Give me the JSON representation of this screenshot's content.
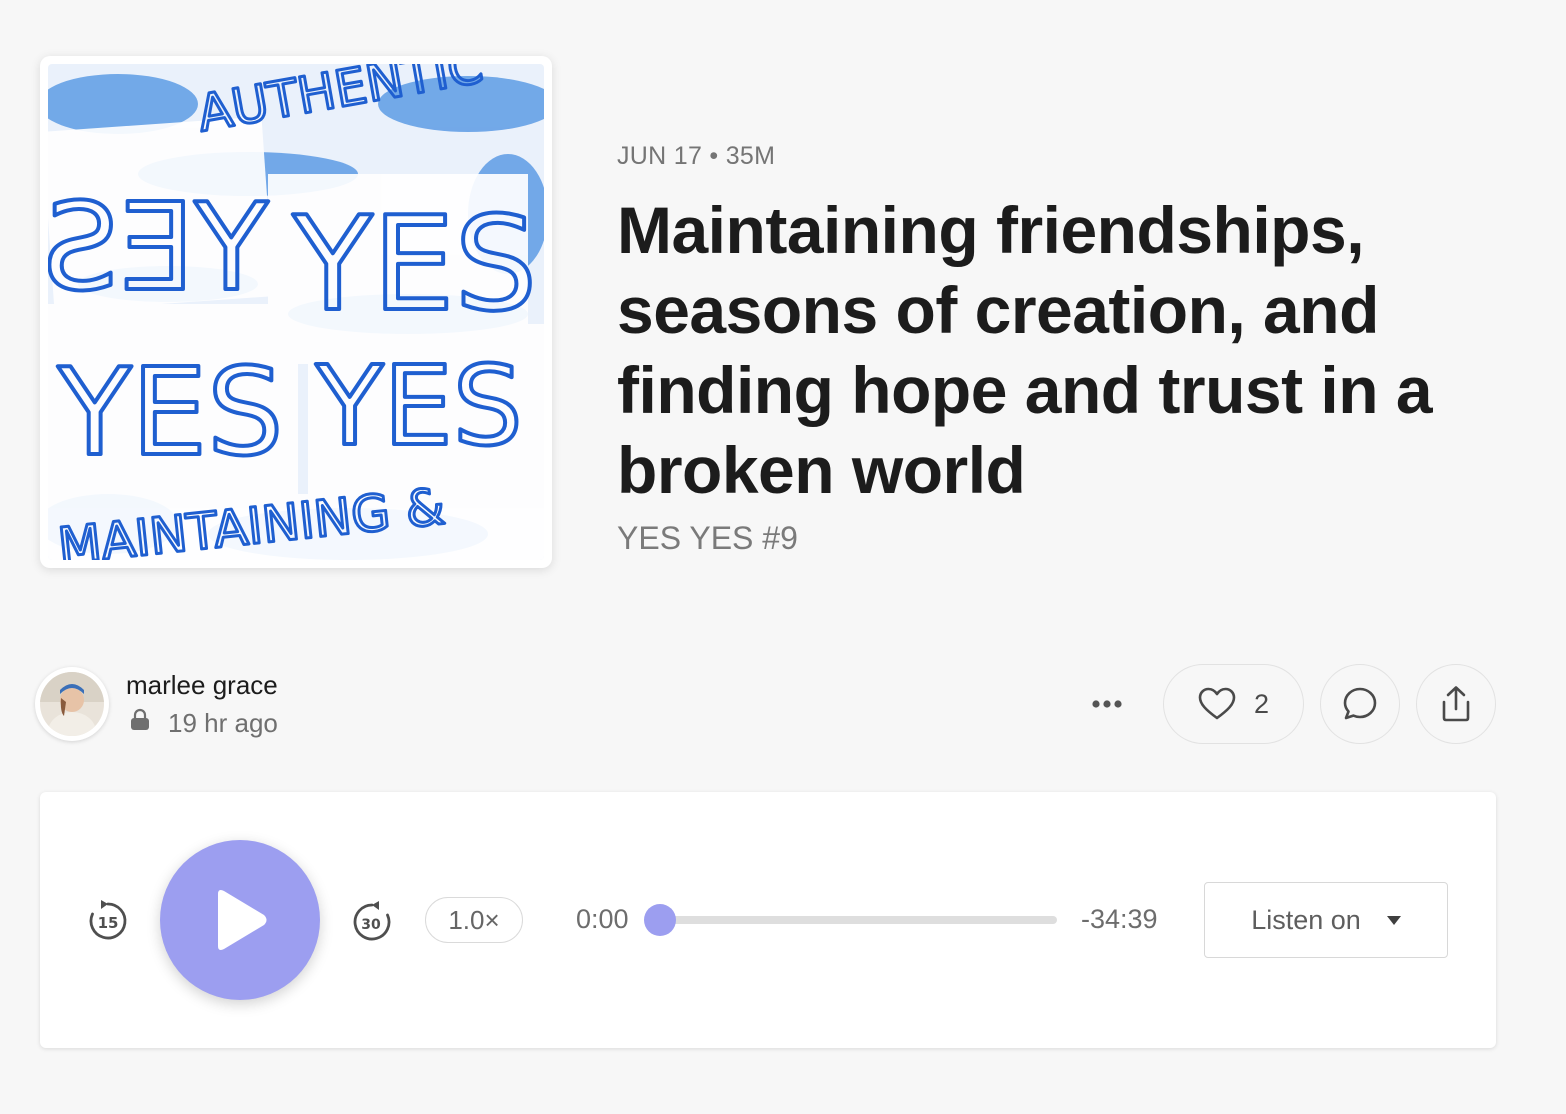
{
  "episode": {
    "meta": "JUN 17 • 35M",
    "title": "Maintaining friendships, seasons of creation, and finding hope and trust in a broken world",
    "subtitle": "YES YES #9",
    "cover_icon": "podcast-cover-art"
  },
  "author": {
    "name": "marlee grace",
    "time": "19 hr ago",
    "lock_icon": "lock-icon"
  },
  "actions": {
    "more_icon": "more-dots-icon",
    "like_count": "2",
    "like_icon": "heart-icon",
    "comment_icon": "comment-bubble-icon",
    "share_icon": "share-icon"
  },
  "player": {
    "skip_back_label": "15",
    "skip_forward_label": "30",
    "speed": "1.0×",
    "elapsed": "0:00",
    "remaining": "-34:39",
    "progress": 0.0,
    "listen_label": "Listen on",
    "accent_color": "#9c9ef0"
  }
}
